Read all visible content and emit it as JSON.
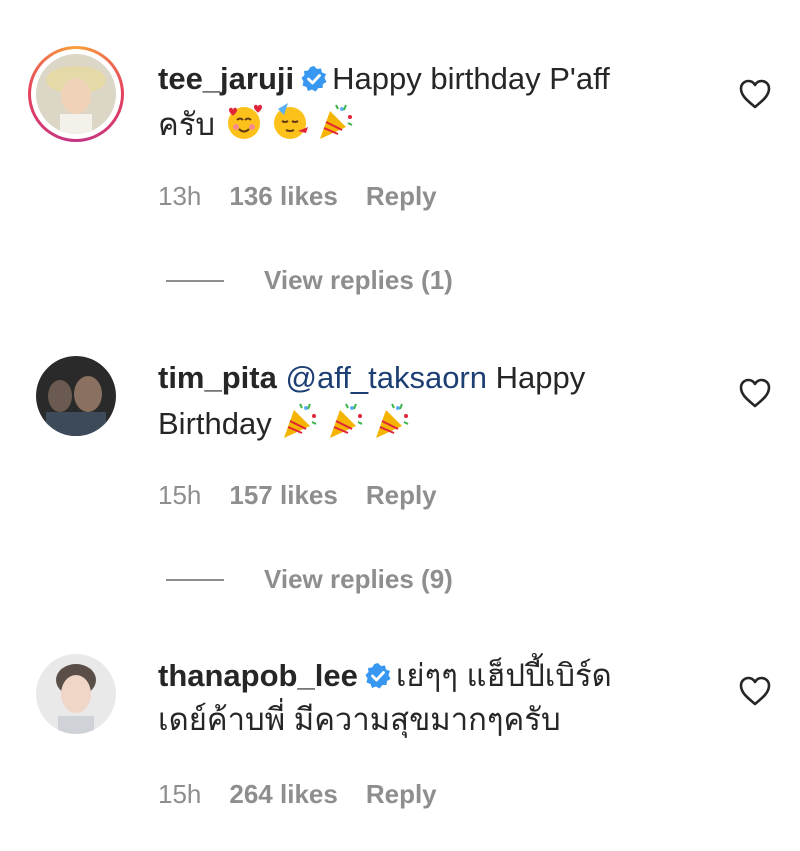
{
  "comments": [
    {
      "username": "tee_jaruji",
      "verified": true,
      "mention": "",
      "text": "Happy birthday P'aff",
      "text2": "ครับ",
      "emoji": [
        "smiling-face-with-hearts",
        "partying-face",
        "party-popper"
      ],
      "time": "13h",
      "likes": "136 likes",
      "reply": "Reply",
      "view_replies": "View replies (1)"
    },
    {
      "username": "tim_pita",
      "verified": false,
      "mention": "@aff_taksaorn",
      "text": "Happy",
      "text2": "Birthday",
      "emoji": [
        "party-popper",
        "party-popper",
        "party-popper"
      ],
      "time": "15h",
      "likes": "157 likes",
      "reply": "Reply",
      "view_replies": "View replies (9)"
    },
    {
      "username": "thanapob_lee",
      "verified": true,
      "mention": "",
      "text": "เย่ๆๆ แฮ็ปปี้เบิร์ด",
      "text2": "เดย์ค้าบพี่ มีความสุขมากๆครับ",
      "emoji": [],
      "time": "15h",
      "likes": "264 likes",
      "reply": "Reply",
      "view_replies": ""
    }
  ],
  "colors": {
    "text": "#262626",
    "muted": "#8e8e8e",
    "mention": "#1d3f73",
    "verified": "#3897f0"
  }
}
